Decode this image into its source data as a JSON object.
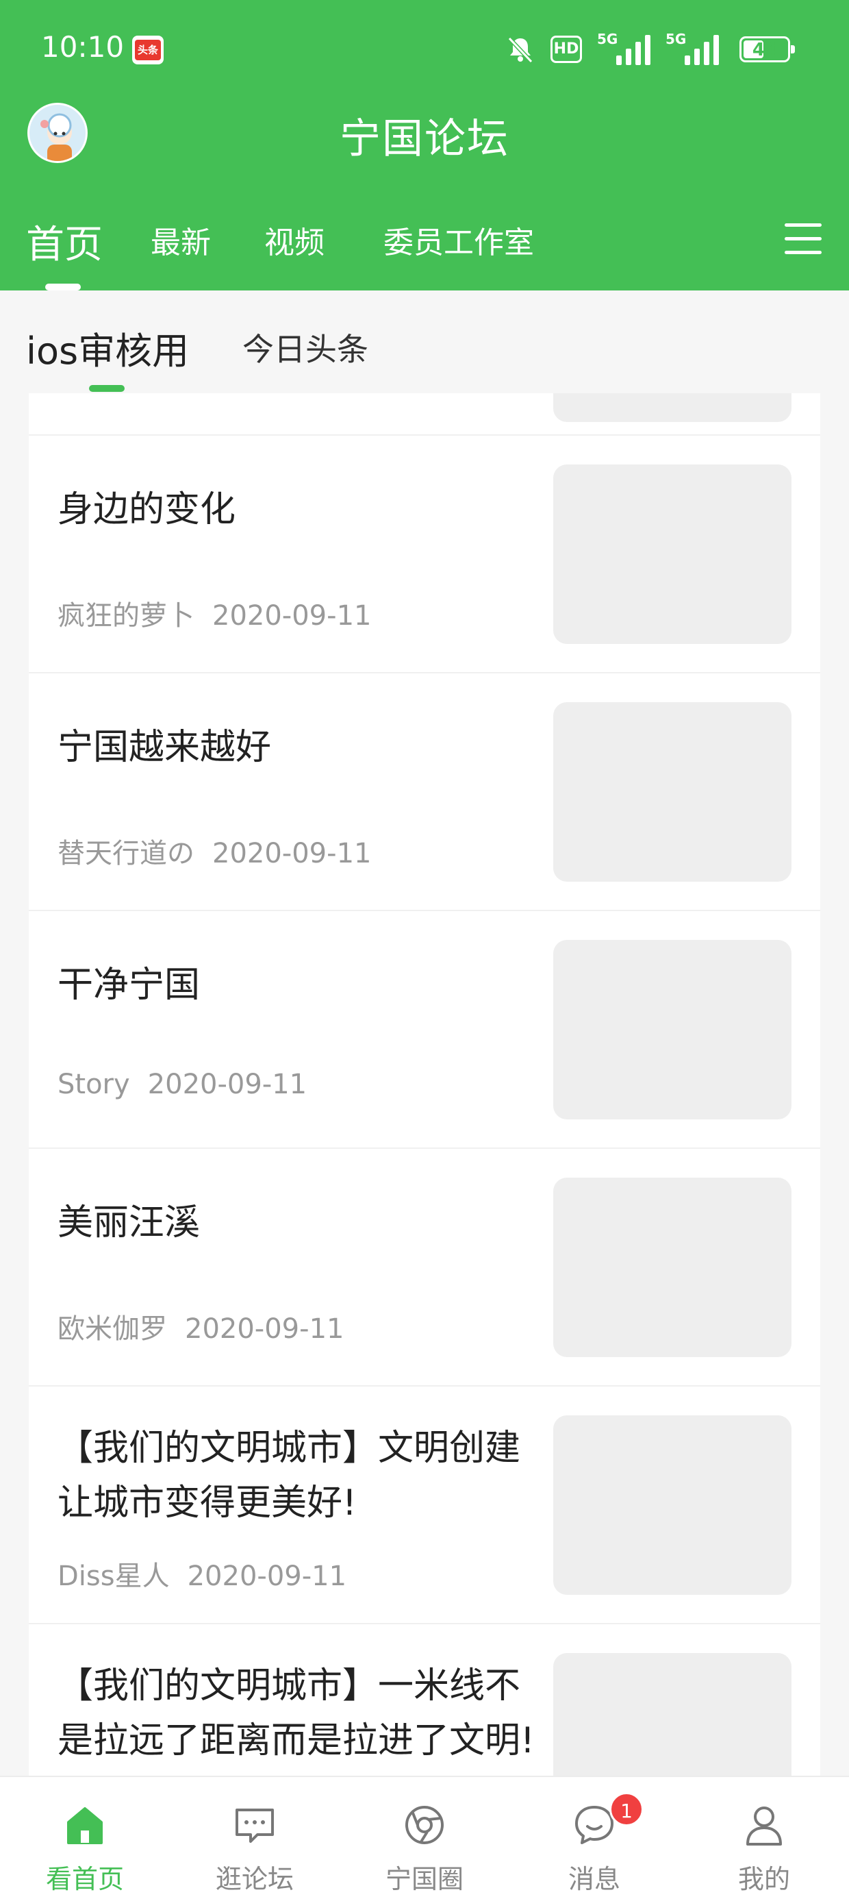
{
  "status_bar": {
    "time": "10:10",
    "app_badge": "头条",
    "hd_label": "HD",
    "signal_label": "5G",
    "battery": "44",
    "icons": [
      "bell-muted-icon",
      "hd-icon",
      "signal-5g-icon",
      "signal-5g-icon",
      "battery-icon"
    ]
  },
  "header": {
    "title": "宁国论坛",
    "tabs": [
      {
        "label": "首页"
      },
      {
        "label": "最新"
      },
      {
        "label": "视频"
      },
      {
        "label": "委员工作室"
      }
    ],
    "accent_color": "#44bf55"
  },
  "sub_tabs": [
    {
      "label": "ios审核用"
    },
    {
      "label": "今日头条"
    }
  ],
  "feed": [
    {
      "title": "身边的变化",
      "author": "疯狂的萝卜",
      "date": "2020-09-11"
    },
    {
      "title": "宁国越来越好",
      "author": "替天行道の",
      "date": "2020-09-11"
    },
    {
      "title": "干净宁国",
      "author": "Story",
      "date": "2020-09-11"
    },
    {
      "title": "美丽汪溪",
      "author": "欧米伽罗",
      "date": "2020-09-11"
    },
    {
      "title": "【我们的文明城市】文明创建让城市变得更美好!",
      "author": "Diss星人",
      "date": "2020-09-11"
    },
    {
      "title": "【我们的文明城市】一米线不是拉远了距离而是拉进了文明!",
      "author": "",
      "date": ""
    }
  ],
  "bottom_nav": [
    {
      "label": "看首页",
      "icon": "home-icon"
    },
    {
      "label": "逛论坛",
      "icon": "forum-icon"
    },
    {
      "label": "宁国圈",
      "icon": "circle-icon"
    },
    {
      "label": "消息",
      "icon": "message-icon",
      "badge": "1"
    },
    {
      "label": "我的",
      "icon": "profile-icon"
    }
  ]
}
